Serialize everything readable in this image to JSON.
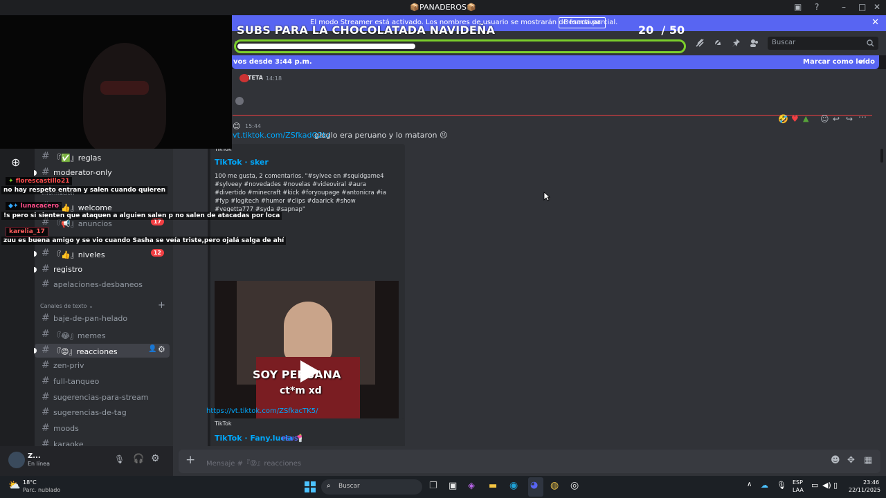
{
  "window": {
    "title": "📦PANADEROS📦"
  },
  "streamer_banner": {
    "text": "El modo Streamer está activado. Los nombres de usuario se mostrarán de forma parcial.",
    "button": "Desactivar"
  },
  "overlay": {
    "title": "SUBS PARA LA CHOCOLATADA NAVIDEÑA",
    "count": "20",
    "total": "/ 50",
    "progress": 0.4
  },
  "header": {
    "search_placeholder": "Buscar",
    "partial": "quef"
  },
  "new_messages": {
    "text": "vos desde 3:44 p.m.",
    "mark_read": "Marcar como leído"
  },
  "messages": {
    "prev_tag": "TETA",
    "prev_time": "14:18",
    "time": "15:44",
    "link1": "vt.tiktok.com/ZSfkadQ2b/",
    "text1": "gloglo era peruano y lo mataron 😣",
    "embed1": {
      "provider": "TikTok",
      "title": "TikTok · sker",
      "description": "100 me gusta, 2 comentarios. \"#sylvee en #squidgame4 #sylveey #novedades #novelas #videoviral #aura #divertido #minecraft #kick #foryoupage #antonicra #ia #fyp #logitech #humor #clips #daarick #show #vegetta777 #syda #sapnap\"",
      "video_caption_1": "SOY PERUANA",
      "video_caption_2": "ct*m xd"
    },
    "link2": "https://vt.tiktok.com/ZSfkacTK5/",
    "embed2": {
      "provider": "TikTok",
      "title": "TikTok · Fany.lucia 🕯️",
      "tag": "PEUS"
    }
  },
  "overlay_chat": [
    {
      "user": "florescastillo21",
      "msg": "no hay respeto entran y salen cuando quieren",
      "color": "#ff4d4d"
    },
    {
      "user": "lunacacero",
      "msg": "!s pero si sienten que ataquen a alguien salen p no salen de atacadas por loca",
      "color": "#ff4d8a"
    },
    {
      "user": "karelia_17",
      "msg": "zuu es buena amigo y se vio cuando Sasha se veía triste,pero ojalá salga de ahí",
      "color": "#ff5c5c"
    }
  ],
  "sidebar": {
    "channels_top": [
      {
        "name": "『✅』reglas"
      },
      {
        "name": "moderator-only"
      },
      {
        "name": "『👍』welcome"
      },
      {
        "name": "『📢』anuncios",
        "badge": "17"
      },
      {
        "name": "『👍』niveles",
        "badge": "12"
      },
      {
        "name": "registro"
      },
      {
        "name": "apelaciones-desbaneos"
      }
    ],
    "category": "Canales de texto",
    "category_partial": "información",
    "channels_text": [
      {
        "name": "baje-de-pan-helado"
      },
      {
        "name": "『😂』memes"
      },
      {
        "name": "『😡』reacciones"
      },
      {
        "name": "zen-priv"
      },
      {
        "name": "full-tanqueo"
      },
      {
        "name": "sugerencias-para-stream"
      },
      {
        "name": "sugerencias-de-tag"
      },
      {
        "name": "moods"
      },
      {
        "name": "karaoke"
      }
    ]
  },
  "user": {
    "name": "Z...",
    "status": "En línea"
  },
  "composer": {
    "placeholder": "Mensaje #『😡』reacciones"
  },
  "taskbar": {
    "temp": "18°C",
    "weather": "Parc. nublado",
    "search": "Buscar",
    "lang1": "ESP",
    "lang2": "LAA",
    "time": "23:46",
    "date": "22/11/2025"
  },
  "colors": {
    "accent": "#5865f2",
    "progress_border": "#7ccf2b",
    "link": "#00a8fc"
  }
}
